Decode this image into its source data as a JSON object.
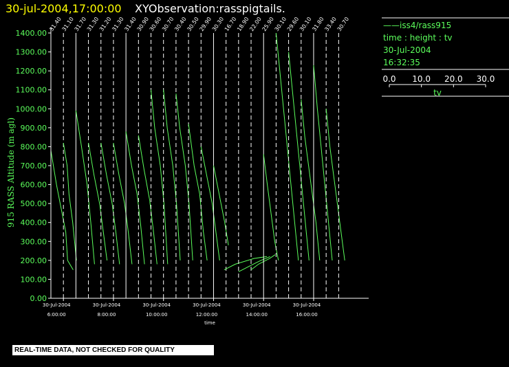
{
  "header": {
    "datetime": "30-jul-2004,17:00:00",
    "observation": "XYObservation:rasspigtails."
  },
  "legend": {
    "series_name": "iss4/rass915",
    "axes_desc": "time : height : tv",
    "date": "30-Jul-2004",
    "time": "16:32:35",
    "scale_ticks": [
      "0.0",
      "10.0",
      "20.0",
      "30.0"
    ],
    "scale_min": 0,
    "scale_max": 30,
    "scale_label": "tv"
  },
  "warning": "REAL-TIME DATA, NOT CHECKED FOR QUALITY",
  "colors": {
    "background": "#000000",
    "axis": "#ffffff",
    "trace": "#5cff5c",
    "title_date": "#ffff00",
    "label": "#5cff5c"
  },
  "chart_data": {
    "type": "line",
    "title": "",
    "xlabel": "time",
    "ylabel": "915 RASS Altitude (m agl)",
    "ylim": [
      0,
      1400
    ],
    "xlim_hours": [
      4.6,
      17.3
    ],
    "y_ticks": [
      "0.00",
      "100.00",
      "200.00",
      "300.00",
      "400.00",
      "500.00",
      "600.00",
      "700.00",
      "800.00",
      "900.00",
      "1000.00",
      "1100.00",
      "1200.00",
      "1300.00",
      "1400.00"
    ],
    "x_ticks": [
      {
        "hour": 5.1,
        "date": "30-Jul-2004",
        "time": "6:00:00"
      },
      {
        "hour": 7.1,
        "date": "30-Jul-2004",
        "time": "8:00:00"
      },
      {
        "hour": 9.1,
        "date": "30-Jul-2004",
        "time": "10:00:00"
      },
      {
        "hour": 11.1,
        "date": "30-Jul-2004",
        "time": "12:00:00"
      },
      {
        "hour": 13.1,
        "date": "30-Jul-2004",
        "time": "14:00:00"
      },
      {
        "hour": 15.1,
        "date": "30-Jul-2004",
        "time": "16:00:00"
      }
    ],
    "profiles": [
      {
        "hour": 4.6,
        "label": "31.40",
        "solid": true,
        "base_top": 780,
        "base_bottom": 0,
        "points": [
          [
            0.0,
            780
          ],
          [
            0.3,
            600
          ],
          [
            0.5,
            500
          ],
          [
            0.8,
            350
          ],
          [
            0.9,
            200
          ],
          [
            1.2,
            150
          ]
        ]
      },
      {
        "hour": 5.1,
        "label": "31.10",
        "solid": false,
        "base_top": 820,
        "base_bottom": 200,
        "points": [
          [
            0.0,
            820
          ],
          [
            0.2,
            700
          ],
          [
            0.3,
            550
          ],
          [
            0.5,
            400
          ],
          [
            0.7,
            200
          ]
        ]
      },
      {
        "hour": 5.6,
        "label": "31.70",
        "solid": true,
        "base_top": 990,
        "base_bottom": 180,
        "points": [
          [
            0.0,
            990
          ],
          [
            0.3,
            800
          ],
          [
            0.6,
            600
          ],
          [
            0.8,
            400
          ],
          [
            1.0,
            180
          ]
        ]
      },
      {
        "hour": 6.1,
        "label": "31.30",
        "solid": false,
        "base_top": 820,
        "base_bottom": 200,
        "points": [
          [
            0.0,
            820
          ],
          [
            0.3,
            650
          ],
          [
            0.6,
            500
          ],
          [
            0.8,
            350
          ],
          [
            1.0,
            200
          ]
        ]
      },
      {
        "hour": 6.6,
        "label": "31.20",
        "solid": false,
        "base_top": 820,
        "base_bottom": 180,
        "points": [
          [
            0.0,
            820
          ],
          [
            0.3,
            650
          ],
          [
            0.6,
            500
          ],
          [
            0.8,
            350
          ],
          [
            1.0,
            180
          ]
        ]
      },
      {
        "hour": 7.1,
        "label": "31.30",
        "solid": false,
        "base_top": 820,
        "base_bottom": 180,
        "points": [
          [
            0.0,
            820
          ],
          [
            0.3,
            650
          ],
          [
            0.6,
            500
          ],
          [
            0.8,
            350
          ],
          [
            1.0,
            180
          ]
        ]
      },
      {
        "hour": 7.6,
        "label": "31.40",
        "solid": true,
        "base_top": 880,
        "base_bottom": 180,
        "points": [
          [
            0.0,
            880
          ],
          [
            0.3,
            700
          ],
          [
            0.6,
            550
          ],
          [
            0.8,
            380
          ],
          [
            1.0,
            180
          ]
        ]
      },
      {
        "hour": 8.1,
        "label": "30.90",
        "solid": false,
        "base_top": 860,
        "base_bottom": 180,
        "points": [
          [
            0.0,
            860
          ],
          [
            0.3,
            680
          ],
          [
            0.6,
            520
          ],
          [
            0.8,
            360
          ],
          [
            1.0,
            180
          ]
        ]
      },
      {
        "hour": 8.6,
        "label": "30.60",
        "solid": false,
        "base_top": 1100,
        "base_bottom": 180,
        "points": [
          [
            0.0,
            1100
          ],
          [
            0.2,
            900
          ],
          [
            0.5,
            700
          ],
          [
            0.7,
            500
          ],
          [
            0.9,
            180
          ]
        ]
      },
      {
        "hour": 9.1,
        "label": "30.70",
        "solid": false,
        "base_top": 1100,
        "base_bottom": 200,
        "points": [
          [
            0.0,
            1100
          ],
          [
            0.2,
            900
          ],
          [
            0.5,
            700
          ],
          [
            0.7,
            500
          ],
          [
            0.9,
            200
          ]
        ]
      },
      {
        "hour": 9.6,
        "label": "30.40",
        "solid": false,
        "base_top": 1080,
        "base_bottom": 200,
        "points": [
          [
            0.0,
            1080
          ],
          [
            0.2,
            900
          ],
          [
            0.5,
            700
          ],
          [
            0.7,
            500
          ],
          [
            0.9,
            200
          ]
        ]
      },
      {
        "hour": 10.1,
        "label": "30.50",
        "solid": false,
        "base_top": 920,
        "base_bottom": 200,
        "points": [
          [
            0.0,
            920
          ],
          [
            0.3,
            700
          ],
          [
            0.6,
            550
          ],
          [
            0.8,
            350
          ],
          [
            1.0,
            200
          ]
        ]
      },
      {
        "hour": 10.6,
        "label": "29.90",
        "solid": false,
        "base_top": 800,
        "base_bottom": 200,
        "points": [
          [
            0.0,
            800
          ],
          [
            0.3,
            650
          ],
          [
            0.6,
            500
          ],
          [
            0.8,
            350
          ],
          [
            1.0,
            200
          ]
        ]
      },
      {
        "hour": 11.1,
        "label": "30.30",
        "solid": true,
        "base_top": 700,
        "base_bottom": 250,
        "points": [
          [
            0.0,
            700
          ],
          [
            0.3,
            550
          ],
          [
            0.6,
            400
          ],
          [
            0.8,
            280
          ]
        ]
      },
      {
        "hour": 11.6,
        "label": "16.70",
        "solid": false,
        "base_top": 0,
        "base_bottom": 0,
        "points": [
          [
            -0.1,
            150
          ],
          [
            0.5,
            180
          ],
          [
            1.5,
            210
          ],
          [
            2.2,
            220
          ]
        ]
      },
      {
        "hour": 12.1,
        "label": "18.90",
        "solid": false,
        "base_top": 0,
        "base_bottom": 0,
        "points": [
          [
            0.0,
            140
          ],
          [
            0.6,
            170
          ],
          [
            1.2,
            200
          ],
          [
            1.7,
            220
          ]
        ]
      },
      {
        "hour": 12.6,
        "label": "22.00",
        "solid": false,
        "base_top": 0,
        "base_bottom": 0,
        "points": [
          [
            0.0,
            150
          ],
          [
            0.4,
            180
          ],
          [
            1.0,
            210
          ],
          [
            1.3,
            230
          ]
        ]
      },
      {
        "hour": 13.1,
        "label": "25.90",
        "solid": true,
        "base_top": 760,
        "base_bottom": 200,
        "points": [
          [
            0.0,
            760
          ],
          [
            0.2,
            600
          ],
          [
            0.4,
            450
          ],
          [
            0.6,
            300
          ],
          [
            0.8,
            200
          ]
        ]
      },
      {
        "hour": 13.6,
        "label": "30.10",
        "solid": false,
        "base_top": 1400,
        "base_bottom": 200,
        "points": [
          [
            0.0,
            1400
          ],
          [
            0.2,
            1200
          ],
          [
            0.4,
            1000
          ],
          [
            0.6,
            800
          ],
          [
            0.8,
            600
          ],
          [
            1.0,
            400
          ],
          [
            1.2,
            200
          ]
        ]
      },
      {
        "hour": 14.1,
        "label": "29.60",
        "solid": false,
        "base_top": 1300,
        "base_bottom": 200,
        "points": [
          [
            0.0,
            1300
          ],
          [
            0.2,
            1100
          ],
          [
            0.4,
            900
          ],
          [
            0.6,
            700
          ],
          [
            0.8,
            500
          ],
          [
            1.0,
            300
          ],
          [
            1.1,
            200
          ]
        ]
      },
      {
        "hour": 14.6,
        "label": "30.10",
        "solid": false,
        "base_top": 1050,
        "base_bottom": 200,
        "points": [
          [
            0.0,
            1050
          ],
          [
            0.2,
            850
          ],
          [
            0.4,
            700
          ],
          [
            0.6,
            550
          ],
          [
            0.8,
            400
          ],
          [
            1.0,
            200
          ]
        ]
      },
      {
        "hour": 15.1,
        "label": "31.80",
        "solid": true,
        "base_top": 1230,
        "base_bottom": 200,
        "points": [
          [
            0.0,
            1230
          ],
          [
            0.2,
            1000
          ],
          [
            0.4,
            800
          ],
          [
            0.6,
            600
          ],
          [
            0.8,
            400
          ],
          [
            1.0,
            200
          ]
        ]
      },
      {
        "hour": 15.6,
        "label": "33.40",
        "solid": false,
        "base_top": 1000,
        "base_bottom": 200,
        "points": [
          [
            0.0,
            1000
          ],
          [
            0.2,
            800
          ],
          [
            0.4,
            650
          ],
          [
            0.6,
            500
          ],
          [
            0.8,
            350
          ],
          [
            1.0,
            200
          ]
        ]
      },
      {
        "hour": 16.1,
        "label": "30.70",
        "solid": false,
        "base_top": 0,
        "base_bottom": 0,
        "points": []
      }
    ]
  }
}
